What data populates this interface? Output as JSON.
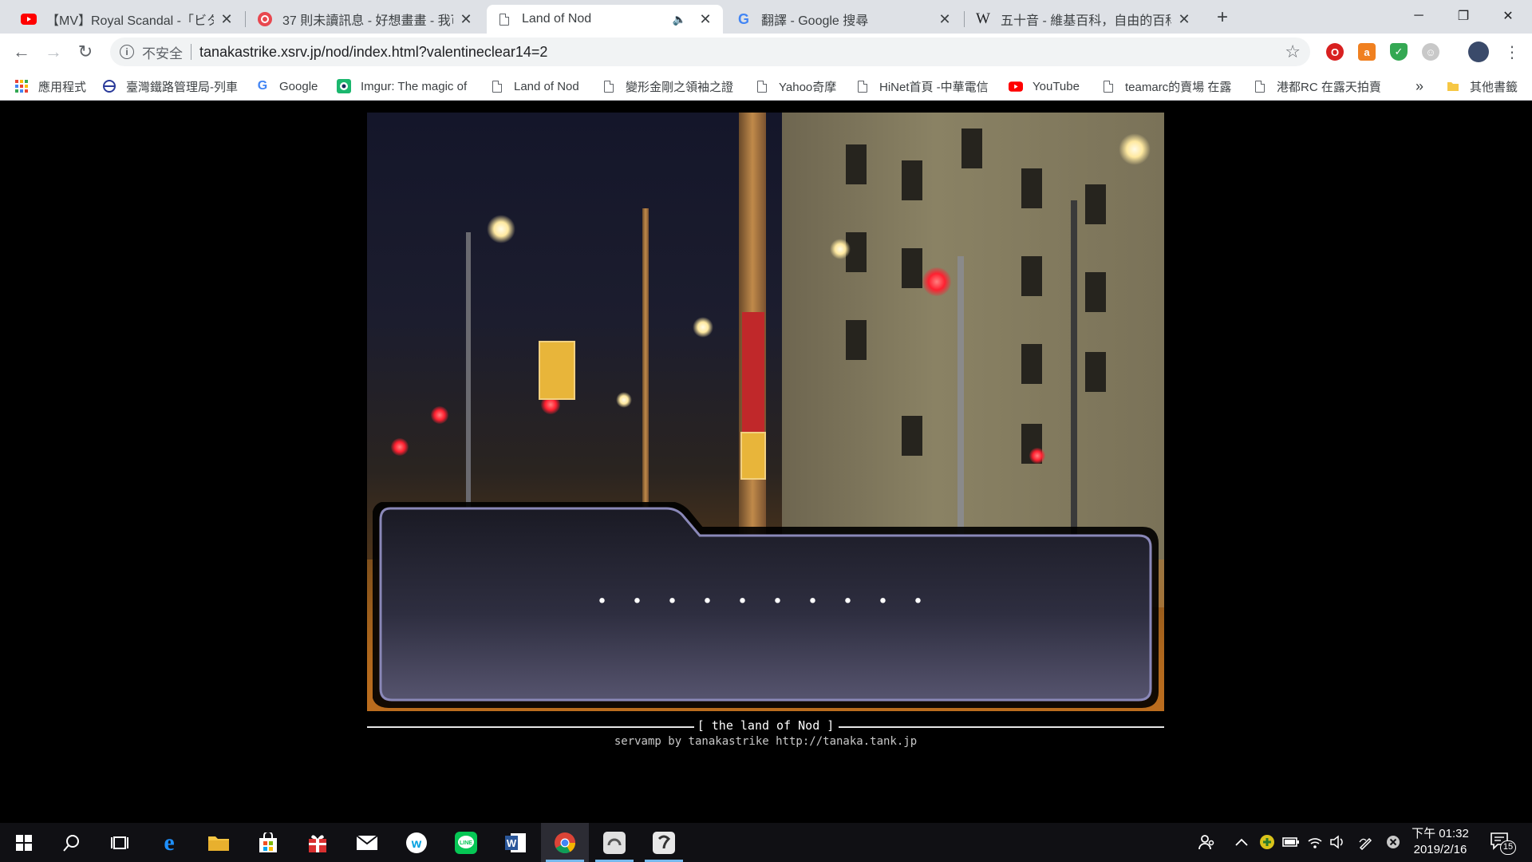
{
  "browser": {
    "tabs": [
      {
        "title": "【MV】Royal Scandal -「ビター",
        "icon": "youtube-icon",
        "active": false
      },
      {
        "title": "37 則未讀訊息 - 好想畫畫 - 我可",
        "icon": "chat-app-icon",
        "active": false
      },
      {
        "title": "Land of Nod",
        "icon": "page-icon",
        "active": true,
        "muted_indicator": "🔈"
      },
      {
        "title": "翻譯 - Google 搜尋",
        "icon": "google-icon",
        "active": false
      },
      {
        "title": "五十音 - 維基百科，自由的百科全",
        "icon": "wikipedia-icon",
        "active": false
      }
    ],
    "tab_close_glyph": "✕",
    "new_tab_glyph": "+",
    "window_controls": {
      "minimize": "─",
      "maximize": "❐",
      "close": "✕"
    },
    "nav": {
      "back": "←",
      "forward": "→",
      "reload": "↻"
    },
    "address": {
      "security_label": "不安全",
      "info_glyph": "i",
      "url": "tanakastrike.xsrv.jp/nod/index.html?valentineclear14=2",
      "star": "☆"
    },
    "bookmarks": [
      {
        "label": "應用程式",
        "icon": "apps-grid-icon"
      },
      {
        "label": "臺灣鐵路管理局-列車",
        "icon": "railway-icon"
      },
      {
        "label": "Google",
        "icon": "google-icon"
      },
      {
        "label": "Imgur: The magic of",
        "icon": "imgur-icon"
      },
      {
        "label": "Land of Nod",
        "icon": "page-icon"
      },
      {
        "label": "變形金剛之領袖之證",
        "icon": "page-icon"
      },
      {
        "label": "Yahoo奇摩",
        "icon": "page-icon"
      },
      {
        "label": "HiNet首頁 -中華電信",
        "icon": "page-icon"
      },
      {
        "label": "YouTube",
        "icon": "youtube-icon"
      },
      {
        "label": "teamarc的賣場 在露",
        "icon": "page-icon"
      },
      {
        "label": "港都RC 在露天拍賣",
        "icon": "page-icon"
      }
    ],
    "bookmarks_overflow": "»",
    "other_bookmarks": "其他書籤"
  },
  "game": {
    "dialog_text": "・・・・・・・・・・",
    "footer_title": "[ the land of Nod ]",
    "footer_credit": "servamp by tanakastrike http://tanaka.tank.jp"
  },
  "taskbar": {
    "clock_time": "下午 01:32",
    "clock_date": "2019/2/16",
    "notification_count": "15"
  },
  "colors": {
    "tabstrip": "#dee1e6",
    "dialog_border": "#8a88b8",
    "dialog_fill_top": "#1a1a24",
    "dialog_fill_bottom": "#56546e"
  }
}
